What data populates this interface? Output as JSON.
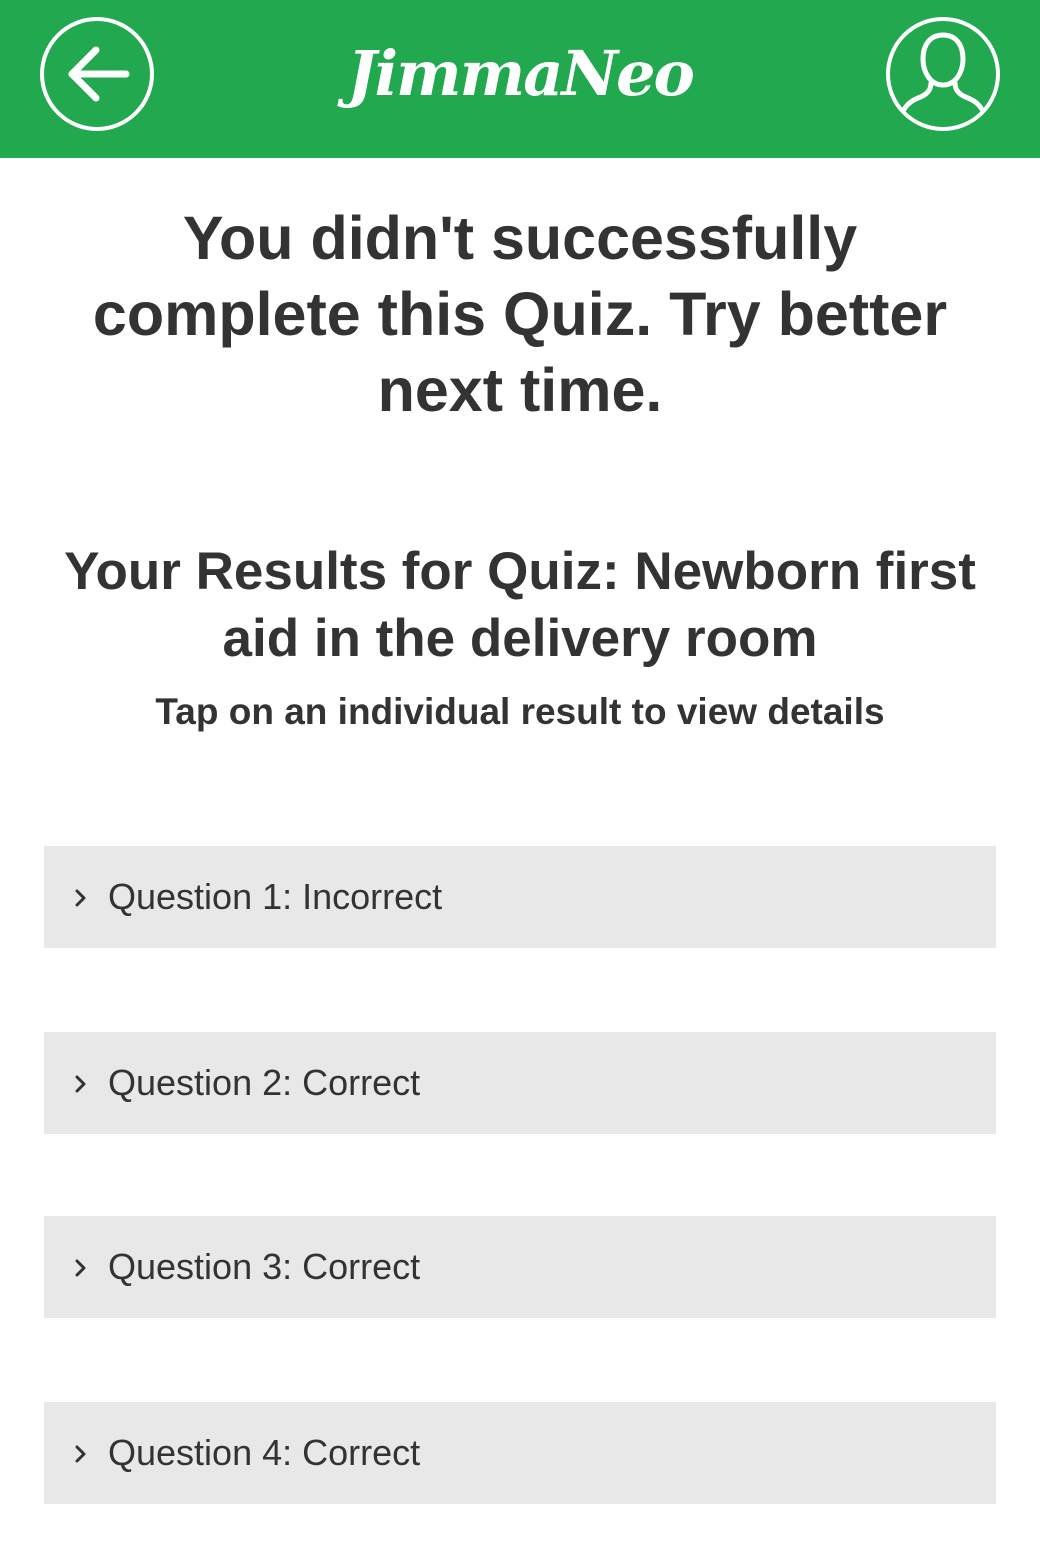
{
  "header": {
    "logo": "JimmaNeo",
    "back_icon": "arrow-left-circle-icon",
    "profile_icon": "user-circle-icon",
    "background_color": "#22a84f"
  },
  "message": "You didn't successfully complete this Quiz. Try better next time.",
  "results": {
    "title": "Your Results for Quiz: Newborn first aid in the delivery room",
    "hint": "Tap on an individual result to view details",
    "items": [
      {
        "label": "Question 1: Incorrect"
      },
      {
        "label": "Question 2: Correct"
      },
      {
        "label": "Question 3: Correct"
      },
      {
        "label": "Question 4: Correct"
      }
    ]
  }
}
